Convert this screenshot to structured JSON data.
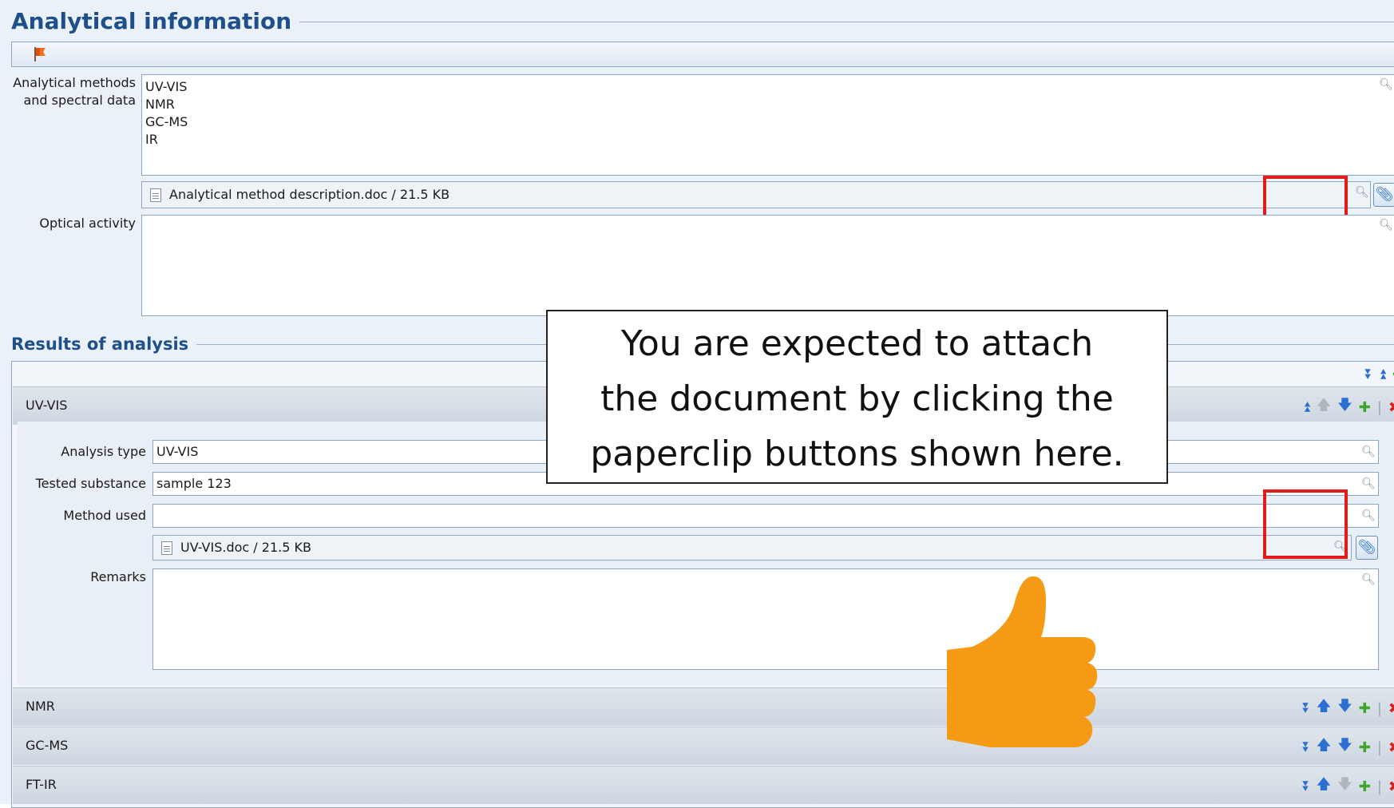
{
  "section1": {
    "title": "Analytical information"
  },
  "fields": {
    "analytical_methods": {
      "label_line1": "Analytical methods",
      "label_line2": "and spectral data",
      "lines": [
        "UV-VIS",
        "NMR",
        "GC-MS",
        "IR"
      ]
    },
    "methods_attachment": "Analytical method description.doc / 21.5 KB",
    "optical_activity": {
      "label": "Optical activity",
      "value": ""
    }
  },
  "section2": {
    "title": "Results of analysis"
  },
  "results": {
    "expanded": {
      "name": "UV-VIS",
      "analysis_type": {
        "label": "Analysis type",
        "value": "UV-VIS"
      },
      "tested_substance": {
        "label": "Tested substance",
        "value": "sample 123"
      },
      "method_used": {
        "label": "Method used",
        "value": ""
      },
      "attachment": "UV-VIS.doc / 21.5 KB",
      "remarks": {
        "label": "Remarks",
        "value": ""
      }
    },
    "collapsed": [
      "NMR",
      "GC-MS",
      "FT-IR"
    ]
  },
  "callout": {
    "line1": "You are expected to attach",
    "line2": "the document by clicking the",
    "line3": "paperclip buttons shown here."
  },
  "colors": {
    "accent": "#1f4f8a",
    "highlight": "#e21b1b",
    "thumb": "#f59a14"
  },
  "icons": {
    "toolbar": "flag-icon",
    "lookup": "magnifier-icon",
    "attach": "paperclip-icon",
    "expand_all": "double-chevron-down-icon",
    "collapse_all": "double-chevron-up-icon",
    "add": "plus-icon",
    "delete": "x-icon",
    "pointer": "thumbs-up-icon"
  }
}
